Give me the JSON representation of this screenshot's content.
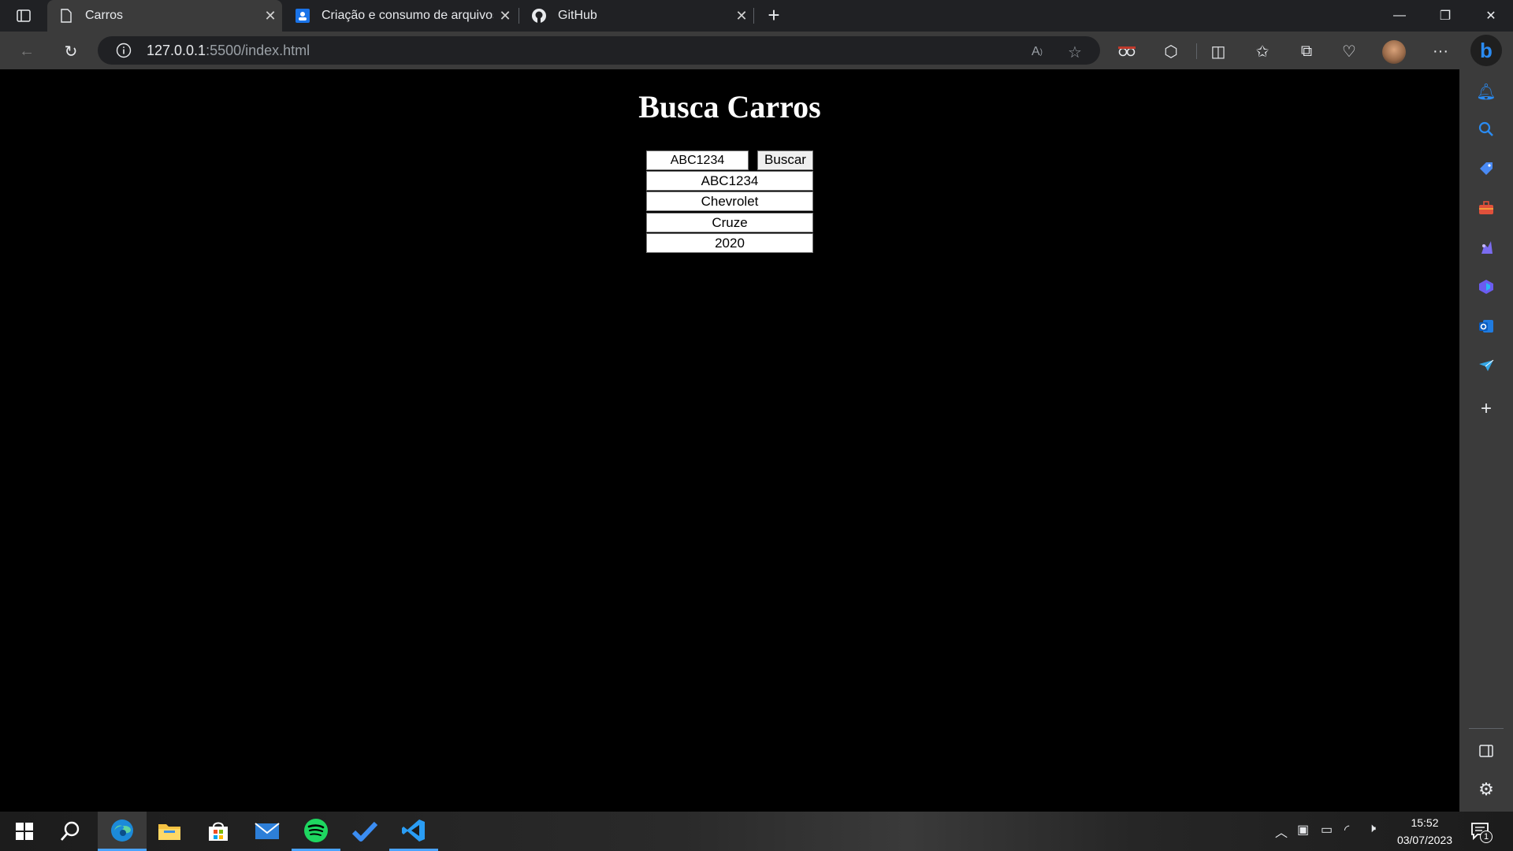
{
  "browser": {
    "tabs": [
      {
        "label": "Carros",
        "icon": "page-icon"
      },
      {
        "label": "Criação e consumo de arquivos J",
        "icon": "contacts-icon"
      },
      {
        "label": "GitHub",
        "icon": "github-icon"
      }
    ],
    "url_host": "127.0.0.1",
    "url_rest": ":5500/index.html"
  },
  "page": {
    "title": "Busca Carros",
    "plate_value": "ABC1234",
    "search_label": "Buscar",
    "results": [
      "ABC1234",
      "Chevrolet",
      "Cruze",
      "2020"
    ]
  },
  "taskbar": {
    "time": "15:52",
    "date": "03/07/2023",
    "notification_count": "1"
  },
  "colors": {
    "accent": "#4aa3ff",
    "chrome_dark": "#202124",
    "chrome": "#3b3b3b",
    "page_bg": "#000000"
  }
}
